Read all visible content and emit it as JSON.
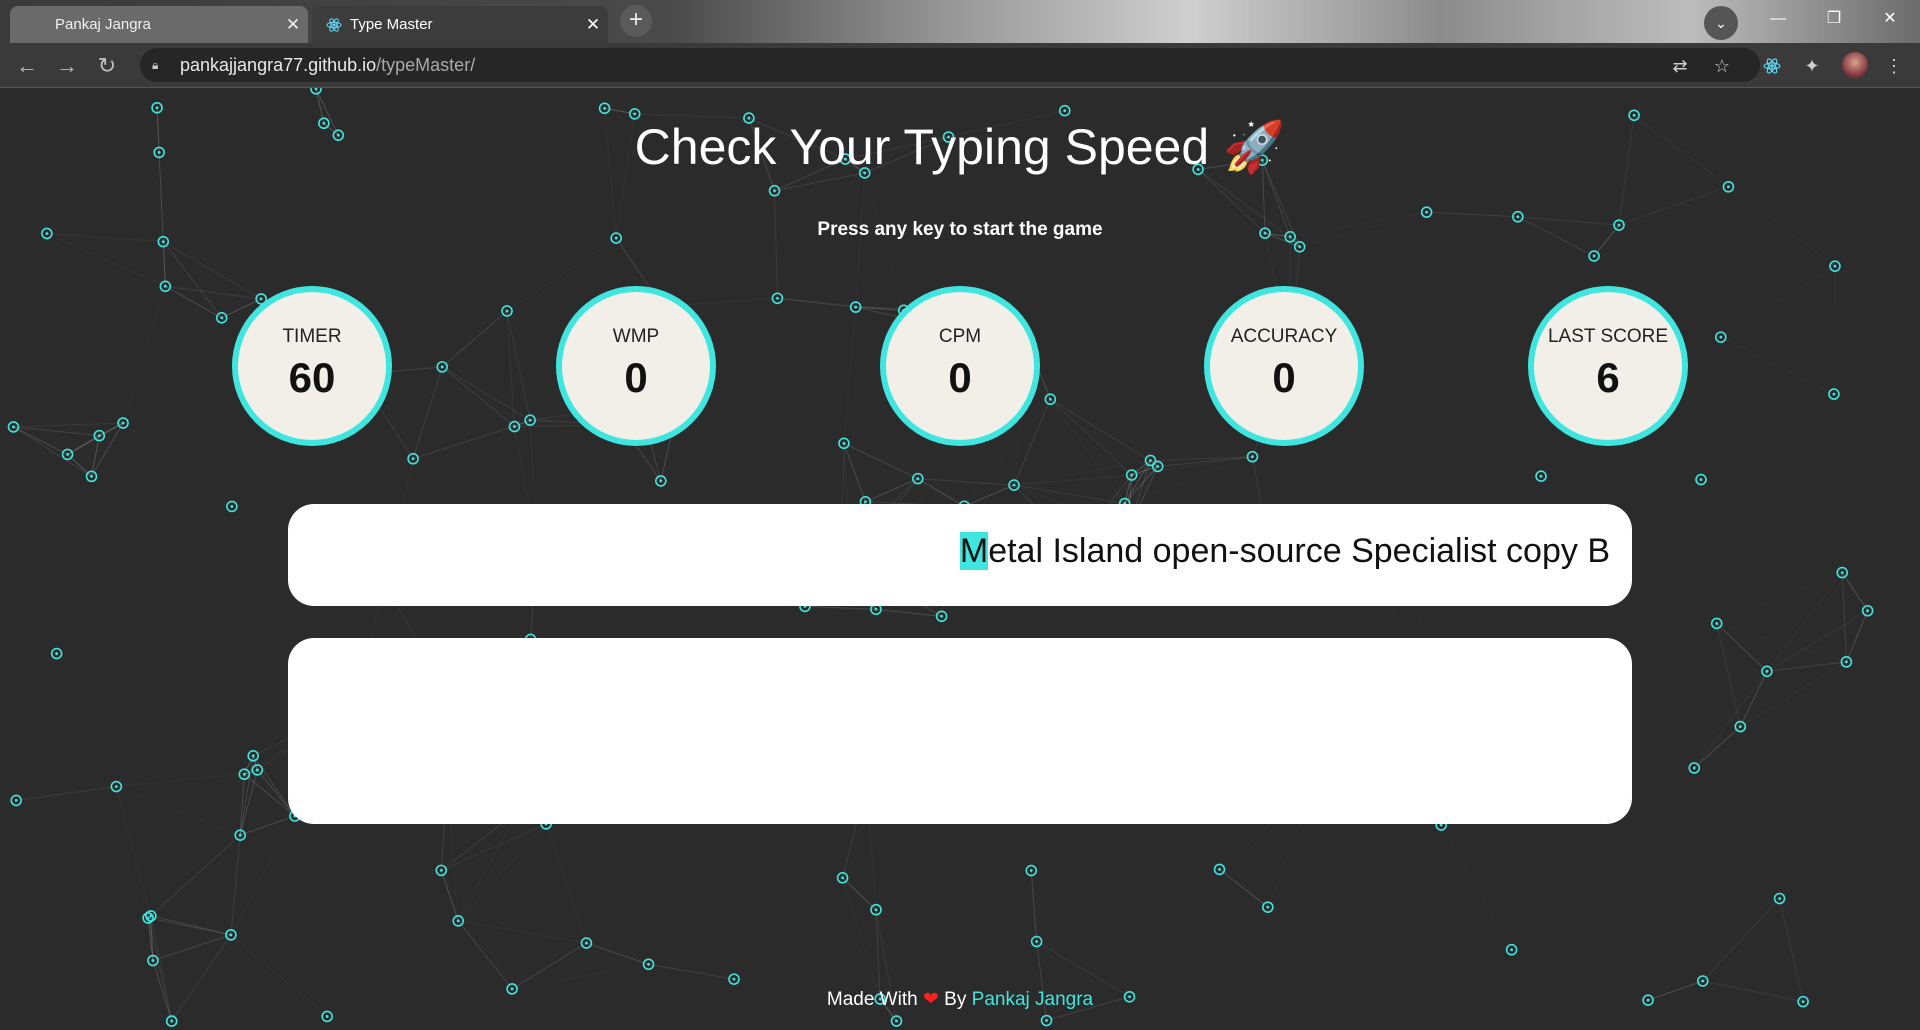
{
  "browser": {
    "tabs": [
      {
        "title": "Pankaj Jangra",
        "active": false
      },
      {
        "title": "Type Master",
        "active": true
      }
    ],
    "url_host": "pankajjangra77.github.io",
    "url_path": "/typeMaster/"
  },
  "page": {
    "title": "Check Your Typing Speed",
    "title_emoji": "🚀",
    "subtitle": "Press any key to start the game",
    "stats": [
      {
        "label": "TIMER",
        "value": "60"
      },
      {
        "label": "WMP",
        "value": "0"
      },
      {
        "label": "CPM",
        "value": "0"
      },
      {
        "label": "ACCURACY",
        "value": "0"
      },
      {
        "label": "LAST SCORE",
        "value": "6"
      }
    ],
    "text_to_type": {
      "cursor_char": "M",
      "rest": "etal Island open-source Specialist copy B"
    },
    "footer": {
      "prefix": "Made With",
      "heart": "❤",
      "by": "By",
      "author": "Pankaj Jangra"
    }
  },
  "colors": {
    "accent": "#3ee6df",
    "background": "#2b2b2b",
    "circle_fill": "#f2efe9",
    "heart": "#ff2020"
  }
}
